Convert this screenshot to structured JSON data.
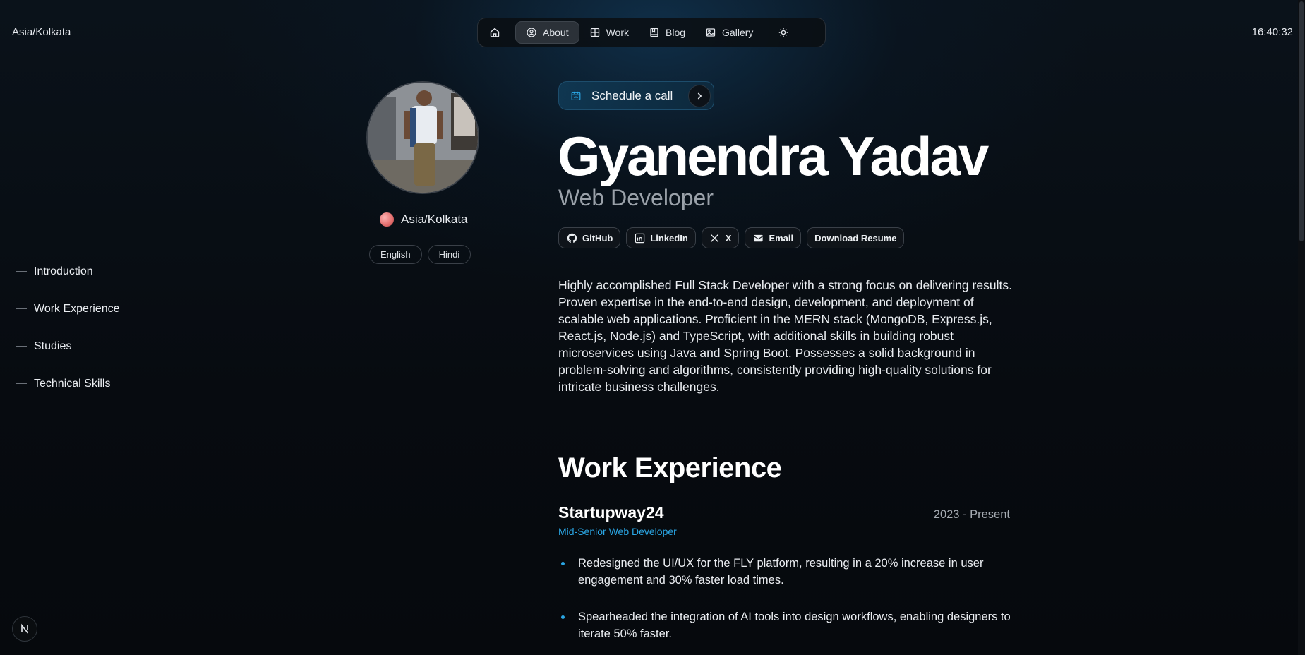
{
  "header": {
    "timezone": "Asia/Kolkata",
    "clock": "16:40:32",
    "nav": {
      "home_icon": "home-icon",
      "items": [
        {
          "label": "About",
          "icon": "user-circle-icon",
          "active": true
        },
        {
          "label": "Work",
          "icon": "grid-icon",
          "active": false
        },
        {
          "label": "Blog",
          "icon": "book-icon",
          "active": false
        },
        {
          "label": "Gallery",
          "icon": "image-icon",
          "active": false
        }
      ],
      "theme_icon": "sun-icon"
    }
  },
  "profile": {
    "location": "Asia/Kolkata",
    "languages": [
      "English",
      "Hindi"
    ]
  },
  "toc": [
    "Introduction",
    "Work Experience",
    "Studies",
    "Technical Skills"
  ],
  "main": {
    "cta_label": "Schedule a call",
    "name": "Gyanendra Yadav",
    "role": "Web Developer",
    "socials": [
      "GitHub",
      "LinkedIn",
      "X",
      "Email",
      "Download Resume"
    ],
    "summary": "Highly accomplished Full Stack Developer with a strong focus on delivering results. Proven expertise in the end-to-end design, development, and deployment of scalable web applications. Proficient in the MERN stack (MongoDB, Express.js, React.js, Node.js) and TypeScript, with additional skills in building robust microservices using Java and Spring Boot. Possesses a solid background in problem-solving and algorithms, consistently providing high-quality solutions for intricate business challenges.",
    "work": {
      "title": "Work Experience",
      "company": "Startupway24",
      "period": "2023 - Present",
      "role": "Mid-Senior Web Developer",
      "bullets": [
        "Redesigned the UI/UX for the FLY platform, resulting in a 20% increase in user engagement and 30% faster load times.",
        "Spearheaded the integration of AI tools into design workflows, enabling designers to iterate 50% faster."
      ]
    }
  },
  "colors": {
    "accent": "#2aa6e4",
    "background": "#070b10",
    "muted_text": "#9aa1a9"
  }
}
